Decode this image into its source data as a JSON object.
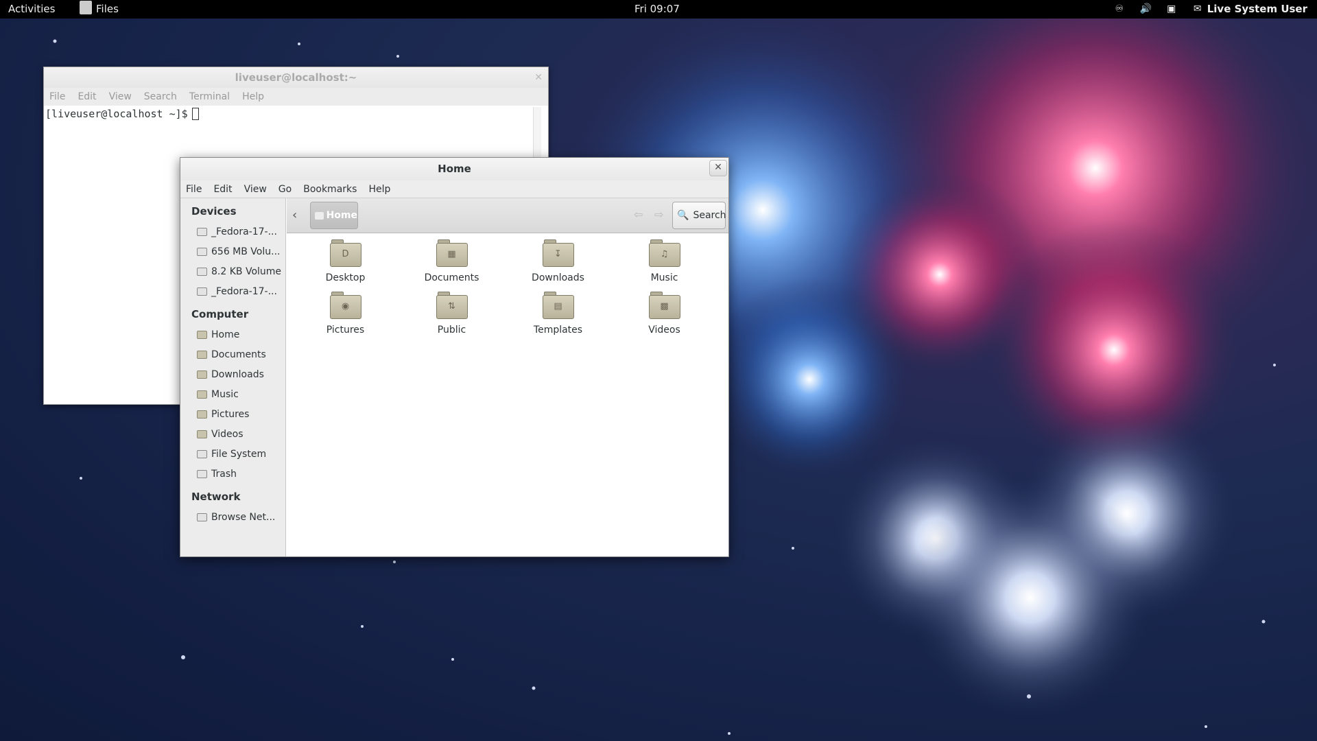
{
  "topbar": {
    "activities": "Activities",
    "app_name": "Files",
    "clock": "Fri 09:07",
    "user": "Live System User",
    "tray_icons": [
      "accessibility-icon",
      "volume-icon",
      "network-icon"
    ]
  },
  "terminal": {
    "title": "liveuser@localhost:~",
    "menu": [
      "File",
      "Edit",
      "View",
      "Search",
      "Terminal",
      "Help"
    ],
    "prompt": "[liveuser@localhost ~]$"
  },
  "files": {
    "title": "Home",
    "menu": [
      "File",
      "Edit",
      "View",
      "Go",
      "Bookmarks",
      "Help"
    ],
    "sidebar": {
      "devices_header": "Devices",
      "devices": [
        "_Fedora-17-...",
        "656 MB Volu...",
        "8.2 KB Volume",
        "_Fedora-17-..."
      ],
      "computer_header": "Computer",
      "computer": [
        "Home",
        "Documents",
        "Downloads",
        "Music",
        "Pictures",
        "Videos",
        "File System",
        "Trash"
      ],
      "network_header": "Network",
      "network": [
        "Browse Net..."
      ]
    },
    "toolbar": {
      "crumb": "Home",
      "search": "Search"
    },
    "folders": [
      "Desktop",
      "Documents",
      "Downloads",
      "Music",
      "Pictures",
      "Public",
      "Templates",
      "Videos"
    ]
  },
  "colors": {
    "topbar": "#000000",
    "wallpaper": "#1d2a52",
    "firework_blue": "#4a8fe0",
    "firework_pink": "#e0306f",
    "firework_white": "#dfe8ff"
  }
}
